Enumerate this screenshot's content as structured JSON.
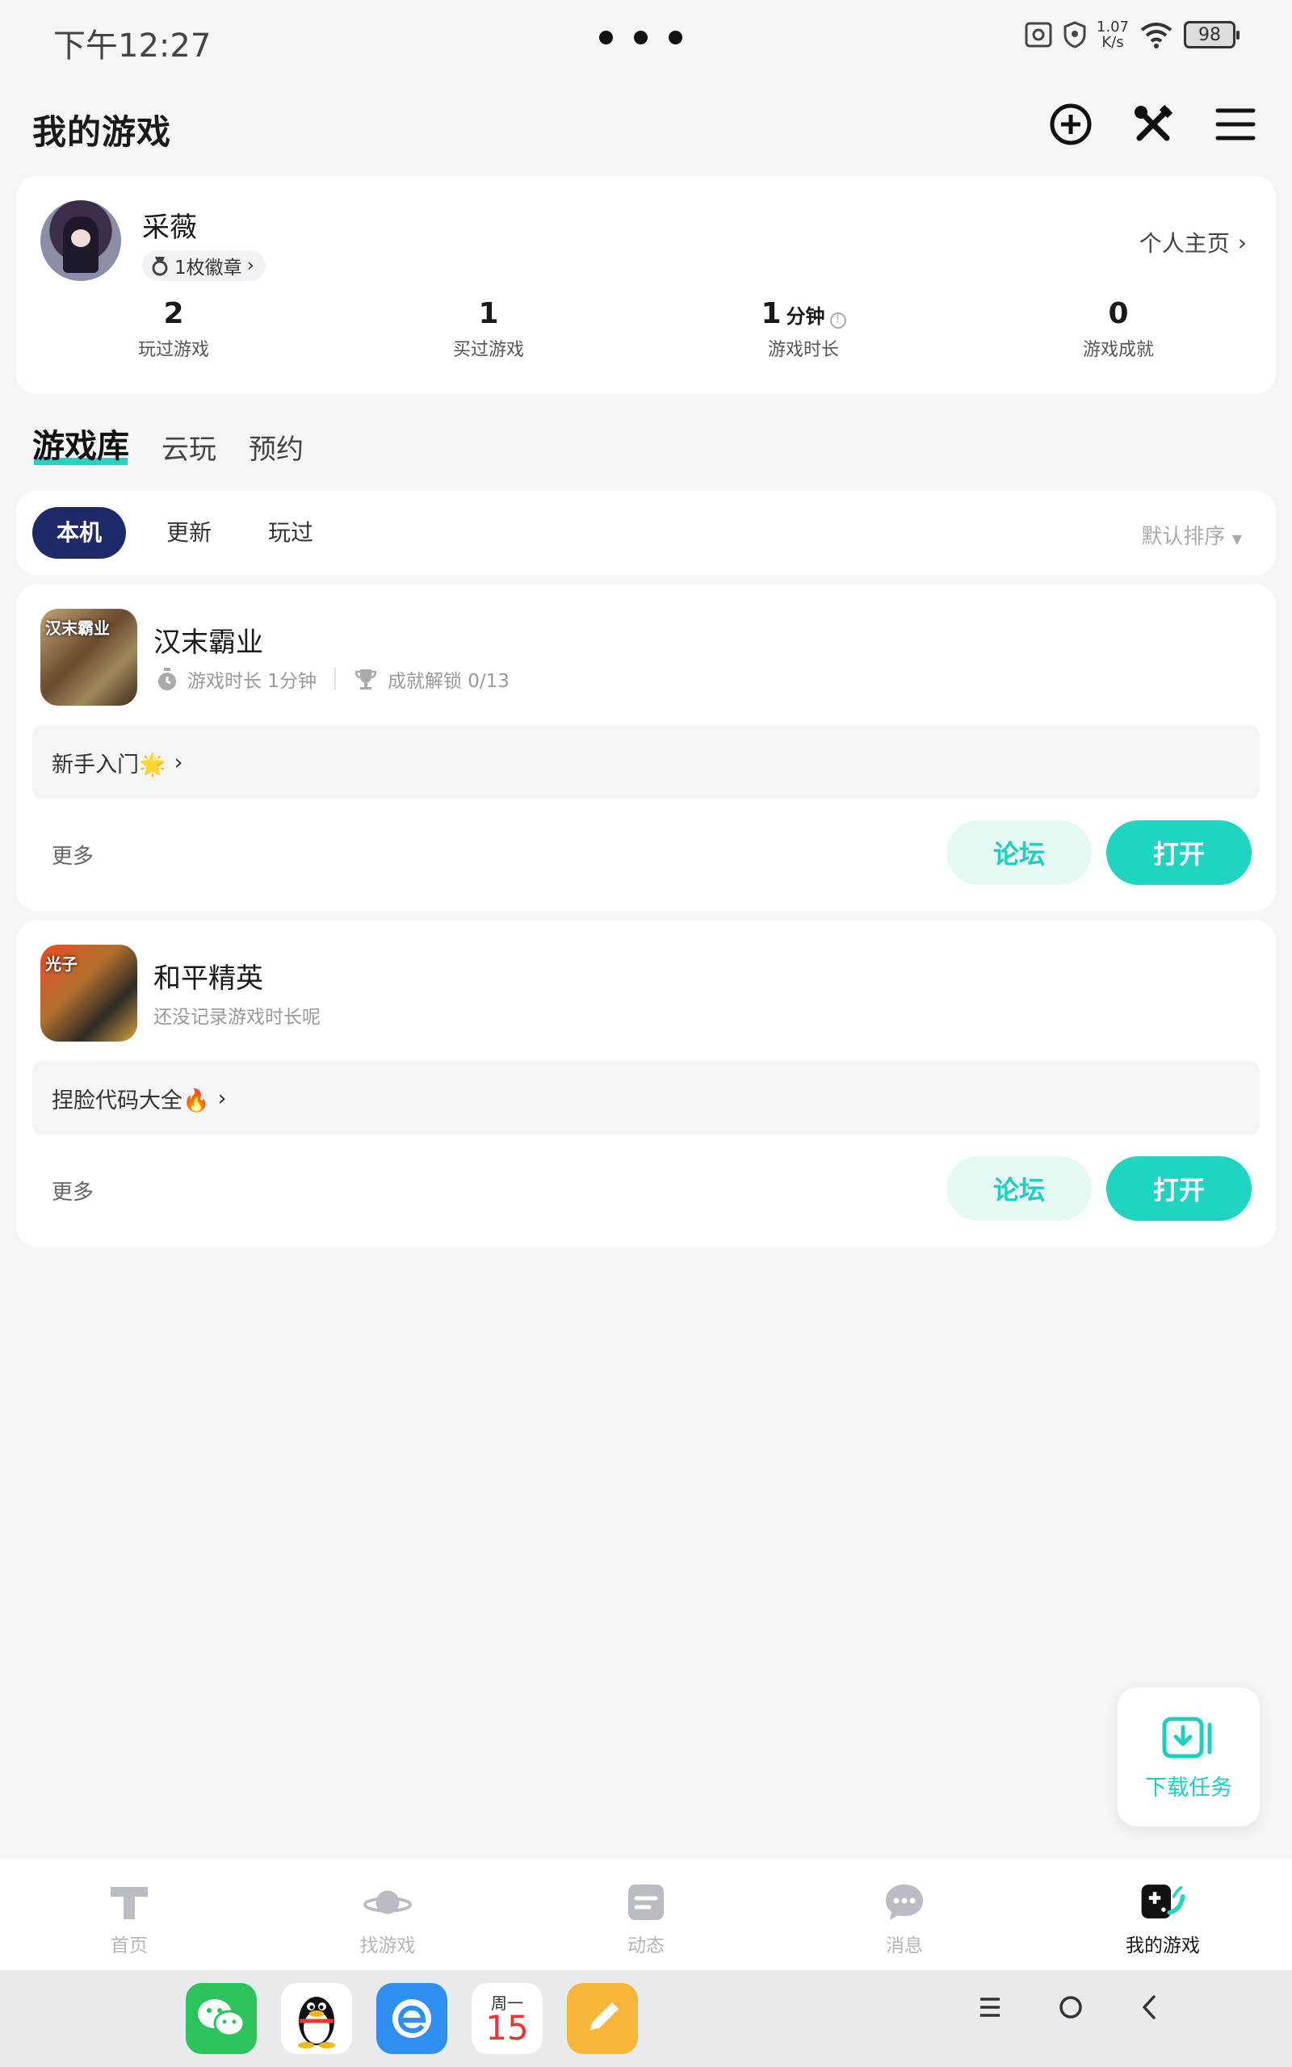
{
  "status_bar": {
    "time": "下午12:27",
    "net_speed_value": "1.07",
    "net_speed_unit": "K/s",
    "battery": "98"
  },
  "header": {
    "title": "我的游戏",
    "icons": [
      "add-circle-icon",
      "tools-icon",
      "menu-icon"
    ]
  },
  "profile": {
    "username": "采薇",
    "badge": "1枚徽章",
    "profile_link": "个人主页",
    "stats": [
      {
        "value": "2",
        "unit": "",
        "label": "玩过游戏"
      },
      {
        "value": "1",
        "unit": "",
        "label": "买过游戏"
      },
      {
        "value": "1",
        "unit": "分钟",
        "label": "游戏时长"
      },
      {
        "value": "0",
        "unit": "",
        "label": "游戏成就"
      }
    ]
  },
  "library_tabs": [
    "游戏库",
    "云玩",
    "预约"
  ],
  "filters": {
    "items": [
      "本机",
      "更新",
      "玩过"
    ],
    "sort": "默认排序"
  },
  "games": [
    {
      "name": "汉末霸业",
      "icon_text": "汉末霸业",
      "play_time": "游戏时长 1分钟",
      "achievements": "成就解锁 0/13",
      "guide": "新手入门🌟",
      "more": "更多",
      "forum_label": "论坛",
      "open_label": "打开"
    },
    {
      "name": "和平精英",
      "icon_text": "光子",
      "no_record": "还没记录游戏时长呢",
      "guide": "捏脸代码大全🔥",
      "more": "更多",
      "forum_label": "论坛",
      "open_label": "打开"
    }
  ],
  "download_task": "下载任务",
  "bottom_nav": [
    {
      "label": "首页",
      "icon": "home-icon"
    },
    {
      "label": "找游戏",
      "icon": "planet-icon"
    },
    {
      "label": "动态",
      "icon": "feed-icon"
    },
    {
      "label": "消息",
      "icon": "message-icon"
    },
    {
      "label": "我的游戏",
      "icon": "gamepad-icon",
      "active": true
    }
  ],
  "dock": {
    "apps": [
      "wechat-app-icon",
      "qq-app-icon",
      "browser-app-icon",
      "calendar-app-icon",
      "notes-app-icon"
    ],
    "calendar_day": "周一",
    "calendar_date": "15"
  },
  "colors": {
    "accent": "#1fd4c1",
    "filter_active": "#1f2a6b",
    "background": "#f4f5f7"
  }
}
